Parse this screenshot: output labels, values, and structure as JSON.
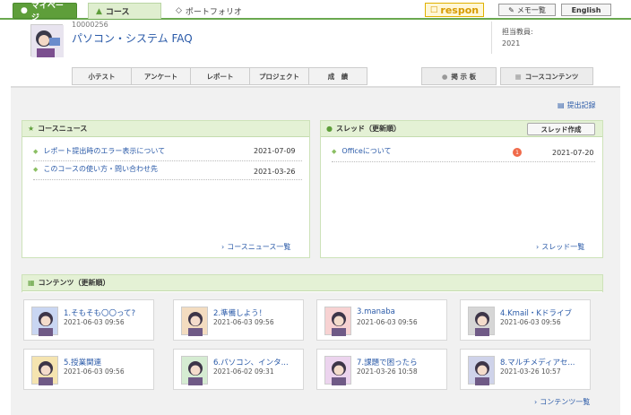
{
  "topnav": {
    "mypage": "マイページ",
    "course": "コース",
    "portfolio": "ポートフォリオ",
    "respon": "respon",
    "memo": "メモ一覧",
    "english": "English"
  },
  "header": {
    "course_code": "10000256",
    "course_title": "パソコン・システム FAQ",
    "teacher_label": "担当教員:",
    "year": "2021",
    "tabs": [
      "小テスト",
      "アンケート",
      "レポート",
      "プロジェクト",
      "成　績"
    ],
    "right_tabs": [
      "掲 示 板",
      "コースコンテンツ"
    ]
  },
  "main": {
    "record_link": "提出記録",
    "news": {
      "title": "コースニュース",
      "items": [
        {
          "text": "レポート提出時のエラー表示について",
          "date": "2021-07-09"
        },
        {
          "text": "このコースの使い方・問い合わせ先",
          "date": "2021-03-26"
        }
      ],
      "more": "コースニュース一覧"
    },
    "threads": {
      "title": "スレッド（更新順）",
      "create_button": "スレッド作成",
      "items": [
        {
          "text": "Officeについて",
          "badge": "1",
          "date": "2021-07-20"
        }
      ],
      "more": "スレッド一覧"
    },
    "contents": {
      "title": "コンテンツ（更新順）",
      "items": [
        {
          "title": "1.そもそも〇〇って?",
          "date": "2021-06-03 09:56",
          "color": "#c9d6f2"
        },
        {
          "title": "2.準備しよう！",
          "date": "2021-06-03 09:56",
          "color": "#f3dcc0"
        },
        {
          "title": "3.manaba",
          "date": "2021-06-03 09:56",
          "color": "#f7d2d2"
        },
        {
          "title": "4.Kmail・Kドライブ",
          "date": "2021-06-03 09:56",
          "color": "#d6d6d6"
        },
        {
          "title": "5.授業関連",
          "date": "2021-06-03 09:56",
          "color": "#f5e4b0"
        },
        {
          "title": "6.パソコン、インタ...",
          "date": "2021-06-02 09:31",
          "color": "#d5ecd2"
        },
        {
          "title": "7.課題で困ったら",
          "date": "2021-03-26 10:58",
          "color": "#ecd4ee"
        },
        {
          "title": "8.マルチメディアセ...",
          "date": "2021-03-26 10:57",
          "color": "#cfd3ea"
        }
      ],
      "more": "コンテンツ一覧"
    }
  }
}
